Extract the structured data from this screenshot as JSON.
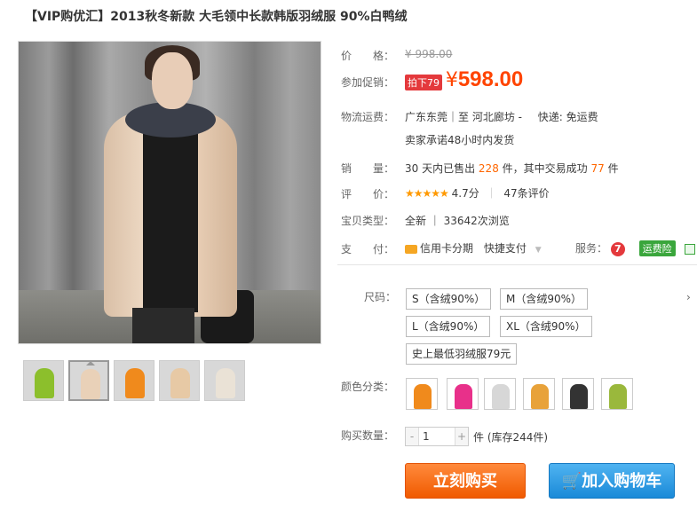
{
  "product": {
    "title": "【VIP购优汇】2013秋冬新款 大毛领中长款韩版羽绒服 90%白鸭绒"
  },
  "price": {
    "label": "价　　格：",
    "original": "¥ 998.00",
    "promo_label": "参加促销：",
    "promo_tag": "拍下79",
    "currency": "¥",
    "value": "598.00"
  },
  "shipping": {
    "label": "物流运费：",
    "route": "广东东莞｜至  河北廊坊 -",
    "fee": "快递: 免运费",
    "note": "卖家承诺48小时内发货"
  },
  "sales": {
    "label": "销　　量：",
    "text_pre": "30 天内已售出",
    "sold": "228",
    "text_mid": "件，其中交易成功",
    "success": "77",
    "text_post": "件"
  },
  "rating": {
    "label": "评　　价：",
    "stars": "★★★★★",
    "score": "4.7分",
    "sep": "｜",
    "reviews": "47条评价"
  },
  "type": {
    "label": "宝贝类型：",
    "value": "全新 ｜ 33642次浏览"
  },
  "payment": {
    "label": "支　　付：",
    "credit": "信用卡分期",
    "quick": "快捷支付",
    "service_label": "服务：",
    "seven": "7",
    "insurance": "运费险"
  },
  "sizes": {
    "label": "尺码：",
    "options": [
      "S（含绒90%）",
      "M（含绒90%）",
      "L（含绒90%）",
      "XL（含绒90%）",
      "史上最低羽绒服79元"
    ],
    "more": "›"
  },
  "colors": {
    "label": "颜色分类：",
    "swatches": [
      "#f08a1c",
      "#e8308a",
      "#d7d7d7",
      "#e8a23a",
      "#333333",
      "#9ab83c"
    ]
  },
  "quantity": {
    "label": "购买数量：",
    "minus": "-",
    "value": "1",
    "plus": "+",
    "stock": "件 (库存244件)"
  },
  "buttons": {
    "buy": "立刻购买",
    "cart": "加入购物车"
  },
  "thumbs": [
    "#8cbf2c",
    "#e9d1b8",
    "#f08a1c",
    "#e7c9a5",
    "#eae2d6"
  ],
  "colors_ui": {
    "accent": "#ff4400",
    "buy": "#f05a00",
    "cart": "#1a8ad8"
  }
}
